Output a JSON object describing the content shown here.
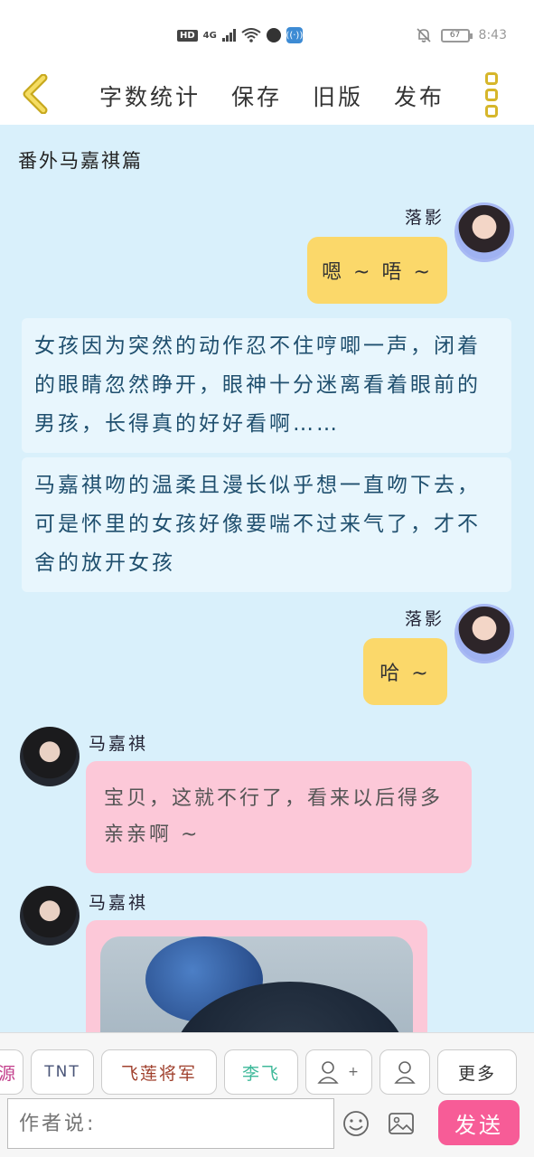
{
  "status_bar": {
    "hd_badge": "HD",
    "network": "4G",
    "battery_level": "67",
    "time": "8:43"
  },
  "header": {
    "links": [
      "字数统计",
      "保存",
      "旧版",
      "发布"
    ]
  },
  "chapter_title": "番外马嘉祺篇",
  "messages": [
    {
      "speaker": "落影",
      "text": "嗯 ~ 唔 ~"
    },
    {
      "narration": "女孩因为突然的动作忍不住哼唧一声，闭着的眼睛忽然睁开，眼神十分迷离看着眼前的男孩，长得真的好好看啊……"
    },
    {
      "narration": "马嘉祺吻的温柔且漫长似乎想一直吻下去，可是怀里的女孩好像要喘不过来气了，才不舍的放开女孩"
    },
    {
      "speaker": "落影",
      "text": "哈 ~"
    },
    {
      "speaker": "马嘉祺",
      "text": "宝贝，这就不行了，看来以后得多亲亲啊 ~"
    },
    {
      "speaker": "马嘉祺"
    }
  ],
  "toolbar": {
    "chips": [
      "源",
      "TNT",
      "飞莲将军",
      "李飞",
      "+",
      "",
      "更多"
    ],
    "input_placeholder": "作者说:",
    "send_label": "发送"
  },
  "colors": {
    "content_bg": "#d9f0fb",
    "yellow_bubble": "#fbd86a",
    "pink_bubble": "#fcc8d8",
    "narration_text": "#1f4f6e",
    "send_button": "#f75c97",
    "chip_feilian": "#a0412e",
    "chip_lifei": "#3fb99a",
    "kebab": "#d6b62b"
  }
}
